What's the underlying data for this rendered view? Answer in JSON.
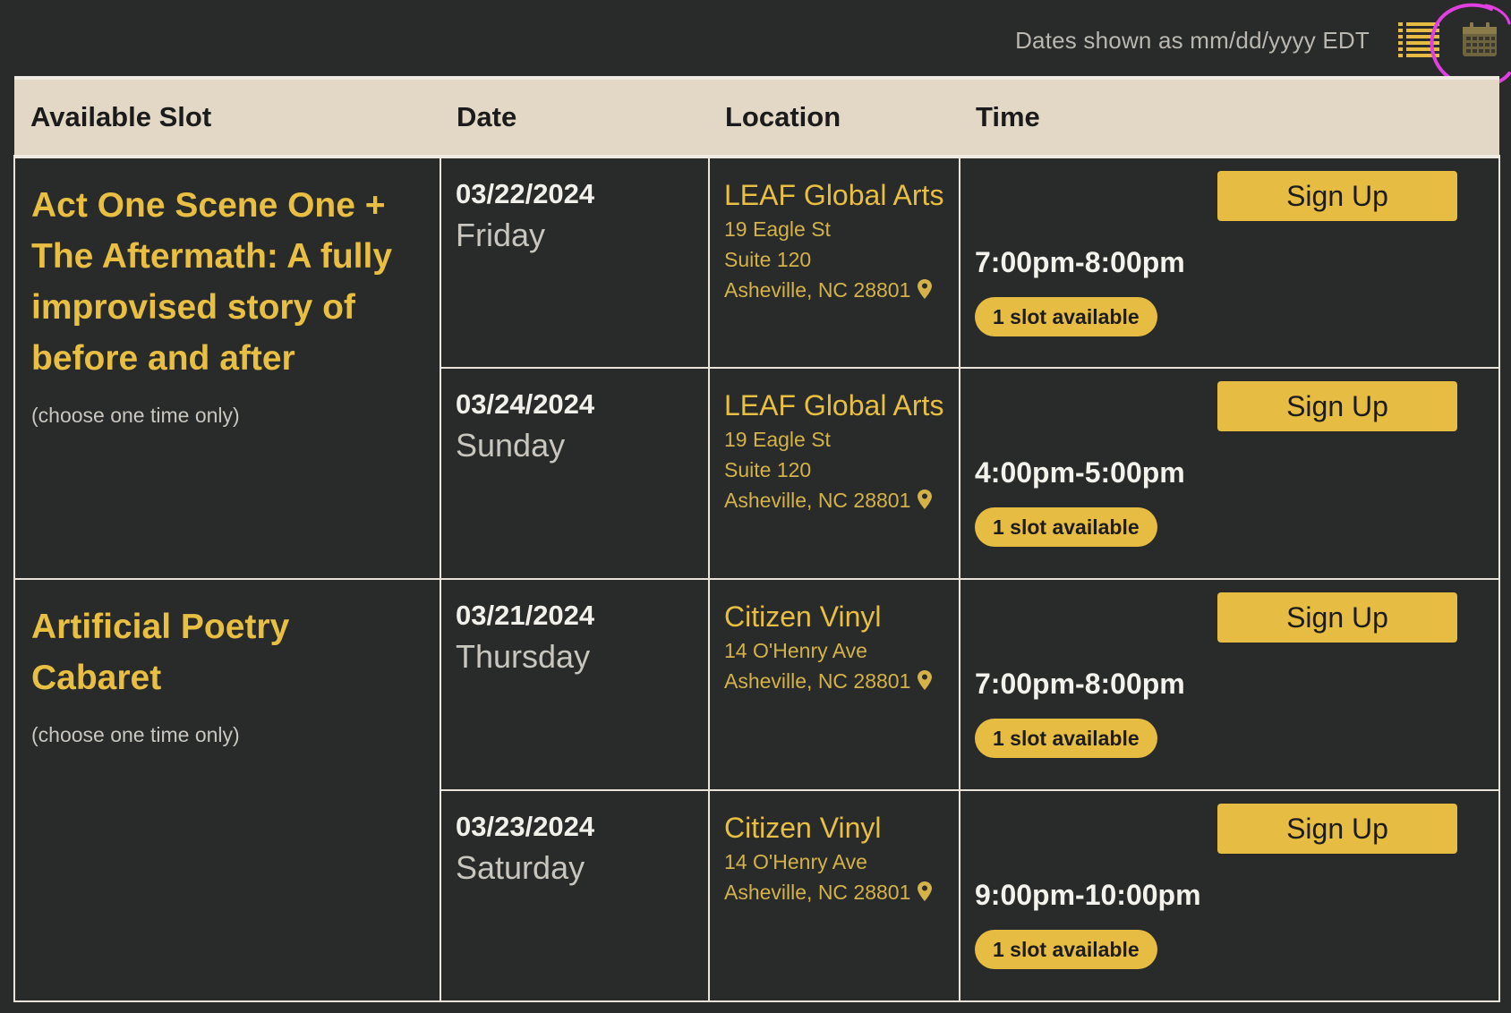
{
  "header": {
    "timezone_note": "Dates shown as mm/dd/yyyy EDT",
    "list_view_icon": "list-view-icon",
    "calendar_view_icon": "calendar-view-icon"
  },
  "colors": {
    "background": "#282b29",
    "header_bg": "#e3d8c5",
    "accent": "#e6bd42",
    "annotation": "#e040e0"
  },
  "table": {
    "columns": [
      "Available Slot",
      "Date",
      "Location",
      "Time"
    ],
    "groups": [
      {
        "title": "Act One Scene One + The Aftermath: A fully improvised story of before and after",
        "note": "(choose one time only)",
        "rows": [
          {
            "date": "03/22/2024",
            "day": "Friday",
            "location_name": "LEAF Global Arts",
            "address": [
              "19 Eagle St",
              "Suite 120",
              "Asheville, NC 28801"
            ],
            "time": "7:00pm-8:00pm",
            "availability": "1 slot available",
            "button": "Sign Up"
          },
          {
            "date": "03/24/2024",
            "day": "Sunday",
            "location_name": "LEAF Global Arts",
            "address": [
              "19 Eagle St",
              "Suite 120",
              "Asheville, NC 28801"
            ],
            "time": "4:00pm-5:00pm",
            "availability": "1 slot available",
            "button": "Sign Up"
          }
        ]
      },
      {
        "title": "Artificial Poetry Cabaret",
        "note": "(choose one time only)",
        "rows": [
          {
            "date": "03/21/2024",
            "day": "Thursday",
            "location_name": "Citizen Vinyl",
            "address": [
              "14 O'Henry Ave",
              "Asheville, NC 28801"
            ],
            "time": "7:00pm-8:00pm",
            "availability": "1 slot available",
            "button": "Sign Up"
          },
          {
            "date": "03/23/2024",
            "day": "Saturday",
            "location_name": "Citizen Vinyl",
            "address": [
              "14 O'Henry Ave",
              "Asheville, NC 28801"
            ],
            "time": "9:00pm-10:00pm",
            "availability": "1 slot available",
            "button": "Sign Up"
          }
        ]
      }
    ]
  }
}
